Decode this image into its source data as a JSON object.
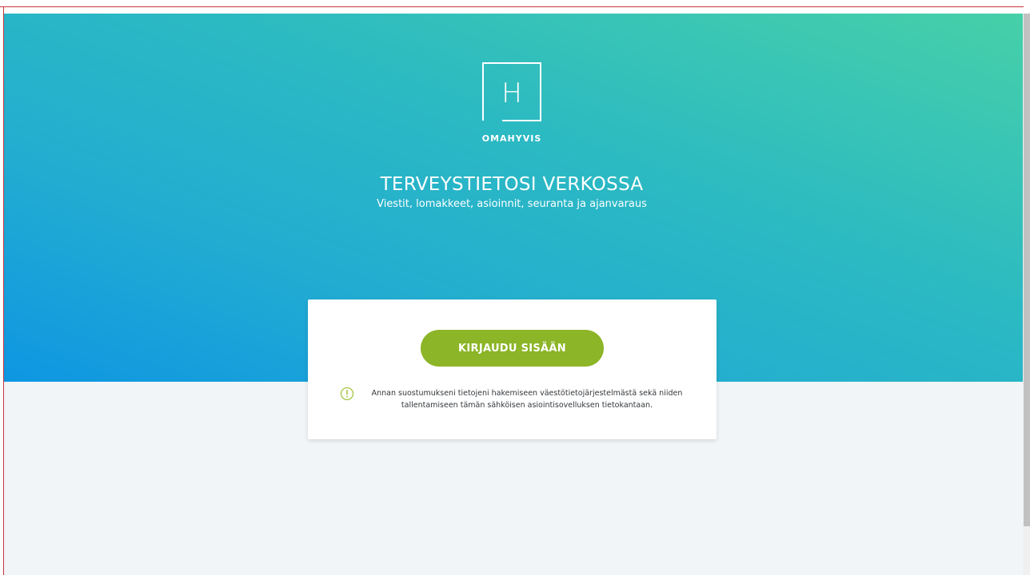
{
  "brand": {
    "logo_letter": "H",
    "name": "OMAHYVIS"
  },
  "hero": {
    "title": "TERVEYSTIETOSI VERKOSSA",
    "subtitle": "Viestit, lomakkeet, asioinnit, seuranta ja ajanvaraus"
  },
  "login_card": {
    "button_label": "KIRJAUDU SISÄÄN",
    "consent_icon": "alert-circle-icon",
    "consent_text": "Annan suostumukseni tietojeni hakemiseen väestötietojärjestelmästä sekä niiden tallentamiseen tämän sähköisen asiointisovelluksen tietokantaan."
  },
  "colors": {
    "gradient_start": "#0e96e2",
    "gradient_end": "#46d0a8",
    "button": "#8cb527",
    "page_background": "#f1f5f7"
  }
}
